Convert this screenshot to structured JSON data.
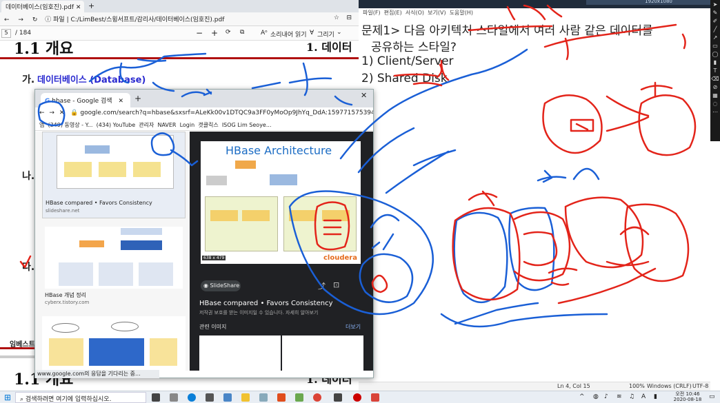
{
  "pdf_viewer": {
    "tab_title": "데이터베이스(임호진).pdf",
    "address": "C:/LimBest/스윙서프트/감리사/데이터베이스(임호진).pdf",
    "file_label": "파일",
    "page_current": "5",
    "page_total": "/ 184",
    "zoom_out": "−",
    "zoom_in": "+",
    "read_aloud": "소리내어 읽기",
    "draw": "그리기",
    "heading_top": "1.1 개요",
    "heading_top_right": "1. 데이터",
    "section_ga_label": "가.",
    "section_ga_title": "데이터베이스 (Database)",
    "section_na": "나.",
    "section_da": "다.",
    "footer_brand": "임베스트",
    "heading_bottom": "1.1 개요",
    "heading_bottom_right": "1. 데이터"
  },
  "notepad": {
    "top_strip_text": "1920x1080",
    "menu": [
      "파일(F)",
      "편집(E)",
      "서식(O)",
      "보기(V)",
      "도움말(H)"
    ],
    "question_line1": "문제1> 다음 아키텍처 스타일에서 여러 사람 같은 데이터를",
    "question_line2": "공유하는 스타일?",
    "option1": "1) Client/Server",
    "option2": "2) Shared Disk",
    "status_pos": "Ln 4, Col 15",
    "status_zoom": "100%",
    "status_eol": "Windows (CRLF)",
    "status_enc": "UTF-8"
  },
  "browser": {
    "tab_title": "hbase - Google 검색",
    "url": "google.com/search?q=hbase&sxsrf=ALeKk00v1DTQC9a3FF0yMoOp9JhYq_DdA:1597715753948&tl...",
    "bookmarks": [
      "앱",
      "(349) 동영상 - Y...",
      "(434) YouTube",
      "관리자",
      "NAVER",
      "Login",
      "갯클릭스",
      "ISOG Lim Seoye..."
    ],
    "left_results": [
      {
        "title": "HBase compared • Favors Consistency",
        "source": "slideshare.net"
      },
      {
        "title": "HBase 개념 정리",
        "source": "cyberx.tistory.com"
      }
    ],
    "preview": {
      "image_title": "HBase Architecture",
      "image_size": "638 x 479",
      "brand": "cloudera",
      "site": "SlideShare",
      "title": "HBase compared • Favors Consistency",
      "note": "저작권 보호를 받는 이미지일 수 있습니다. 자세히 알아보기",
      "related": "관련 이미지",
      "more": "더보기"
    },
    "status_text": "www.google.com의 응답을 기다리는 중..."
  },
  "taskbar": {
    "search_placeholder": "검색하려면 여기에 입력하십시오.",
    "time": "오전 10:46",
    "date": "2020-08-18"
  },
  "annotation_color_blue": "#1a5fd6",
  "annotation_color_red": "#e3241a"
}
